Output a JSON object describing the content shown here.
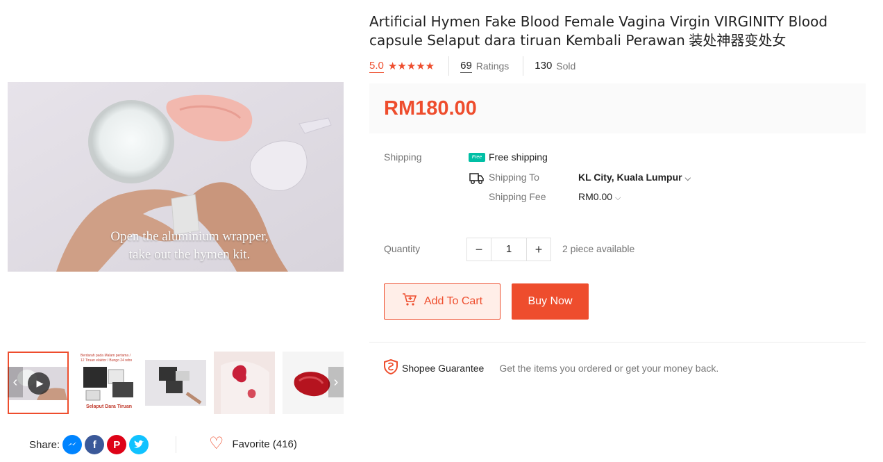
{
  "product": {
    "title": "Artificial Hymen Fake Blood Female Vagina Virgin VIRGINITY Blood capsule Selaput dara tiruan Kembali Perawan",
    "title_cjk": "装处神器变处女",
    "rating": "5.0",
    "stars": "★★★★★",
    "ratings_count": "69",
    "ratings_label": "Ratings",
    "sold_count": "130",
    "sold_label": "Sold",
    "price": "RM180.00"
  },
  "media": {
    "caption_line1": "Open the aluminium wrapper,",
    "caption_line2": "take out the hymen kit.",
    "thumb2_text": "Berdarah pada Malam pertama / 12 Tiruan elaktor / Bungo 24 rebo",
    "thumb2_label": "Selaput Dara Tiruan",
    "thumbnails_count": 5
  },
  "shipping": {
    "label": "Shipping",
    "free_badge": "Free",
    "free_text": "Free shipping",
    "to_label": "Shipping To",
    "to_value": "KL City, Kuala Lumpur",
    "fee_label": "Shipping Fee",
    "fee_value": "RM0.00"
  },
  "quantity": {
    "label": "Quantity",
    "minus": "−",
    "value": "1",
    "plus": "+",
    "available": "2 piece available"
  },
  "actions": {
    "add_to_cart": "Add To Cart",
    "buy_now": "Buy Now"
  },
  "guarantee": {
    "title": "Shopee Guarantee",
    "text": "Get the items you ordered or get your money back."
  },
  "share": {
    "label": "Share:",
    "icons": [
      "messenger-icon",
      "facebook-icon",
      "pinterest-icon",
      "twitter-icon"
    ]
  },
  "favorite": {
    "label": "Favorite (416)"
  },
  "colors": {
    "accent": "#ee4d2d",
    "free_badge": "#00bfa5",
    "messenger": "#0084ff",
    "facebook": "#3b5999",
    "pinterest": "#de0217",
    "twitter": "#10c2ff"
  }
}
